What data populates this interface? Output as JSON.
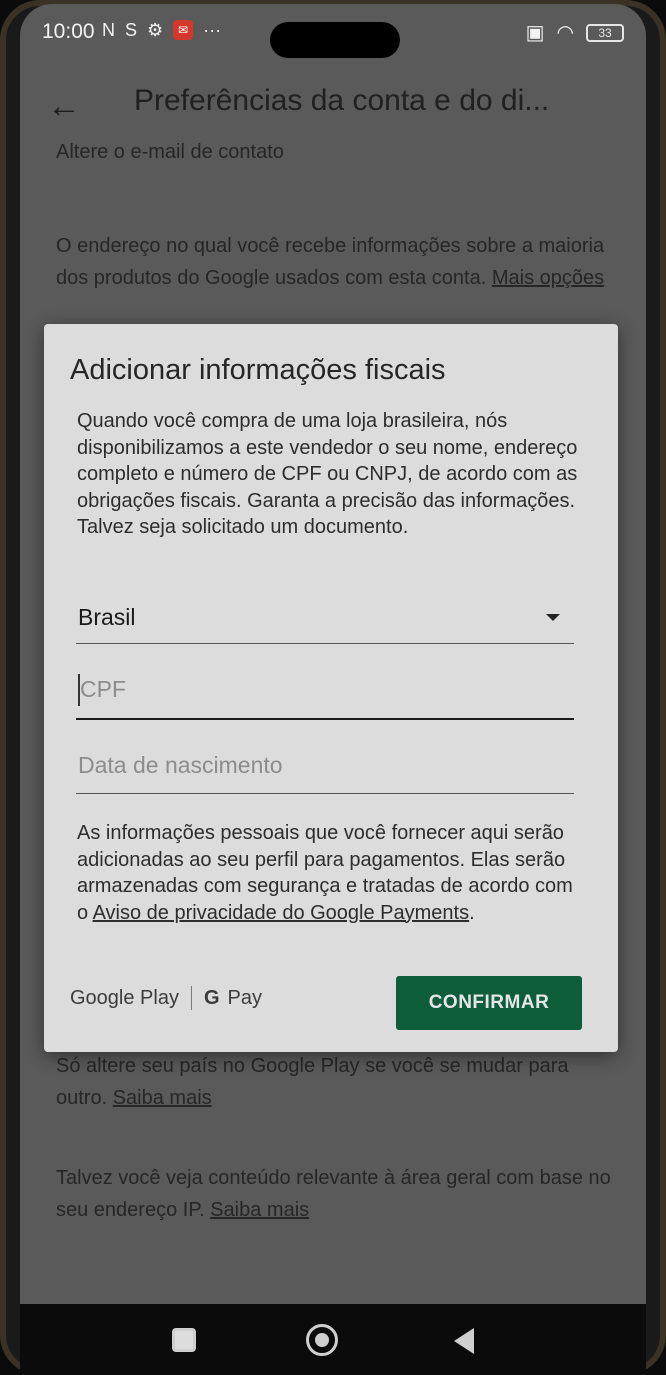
{
  "status": {
    "time": "10:00",
    "battery": "33"
  },
  "app_bar": {
    "title": "Preferências da conta e do di..."
  },
  "background": {
    "partial_top": "Altere o e-mail de contato",
    "email_info": "O endereço no qual você recebe informações sobre a maioria dos produtos do Google usados com esta conta.",
    "email_link": "Mais opções",
    "country_info": "Só altere seu país no Google Play se você se mudar para outro.",
    "country_link": "Saiba mais",
    "ip_info": "Talvez você veja conteúdo relevante à área geral com base no seu endereço IP.",
    "ip_link": "Saiba mais"
  },
  "dialog": {
    "title": "Adicionar informações fiscais",
    "description": "Quando você compra de uma loja brasileira, nós disponibilizamos a este vendedor o seu nome, endereço completo e número de CPF ou CNPJ, de acordo com as obrigações fiscais. Garanta a precisão das informações. Talvez seja solicitado um documento.",
    "country_value": "Brasil",
    "cpf_placeholder": "CPF",
    "birth_placeholder": "Data de nascimento",
    "note": "As informações pessoais que você fornecer aqui serão adicionadas ao seu perfil para pagamentos. Elas serão armazenadas com segurança e tratadas de acordo com o",
    "note_link": "Aviso de privacidade do Google Payments",
    "google_play": "Google Play",
    "gpay_g": "G",
    "gpay": "Pay",
    "confirm_label": "CONFIRMAR"
  }
}
